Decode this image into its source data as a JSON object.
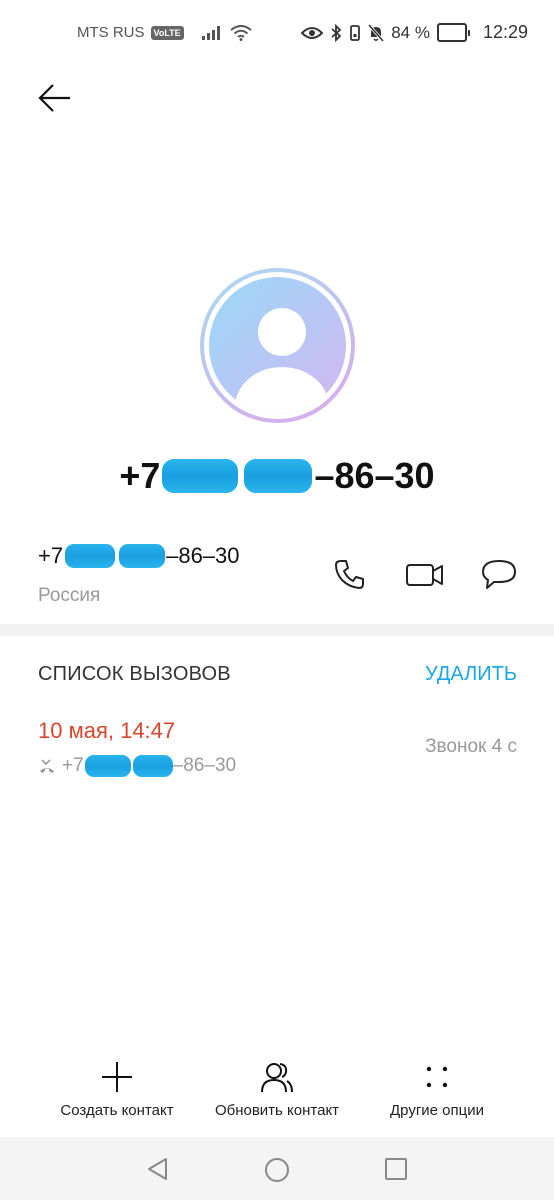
{
  "status_bar": {
    "carrier": "MTS RUS",
    "volte": "VoLTE",
    "battery": "84 %",
    "battery_level": 0.84,
    "time": "12:29"
  },
  "contact": {
    "number_prefix": "+7",
    "number_suffix": "–86–30",
    "country": "Россия"
  },
  "call_list": {
    "title": "СПИСОК ВЫЗОВОВ",
    "delete_label": "УДАЛИТЬ",
    "items": [
      {
        "date": "10 мая, 14:47",
        "number_prefix": "+7",
        "number_suffix": "–86–30",
        "duration": "Звонок 4 с"
      }
    ]
  },
  "bottom_actions": {
    "create": "Создать контакт",
    "update": "Обновить контакт",
    "more": "Другие опции"
  },
  "colors": {
    "accent": "#1aa6e6",
    "missed": "#d8452c",
    "redaction": "#1fa9e8"
  }
}
